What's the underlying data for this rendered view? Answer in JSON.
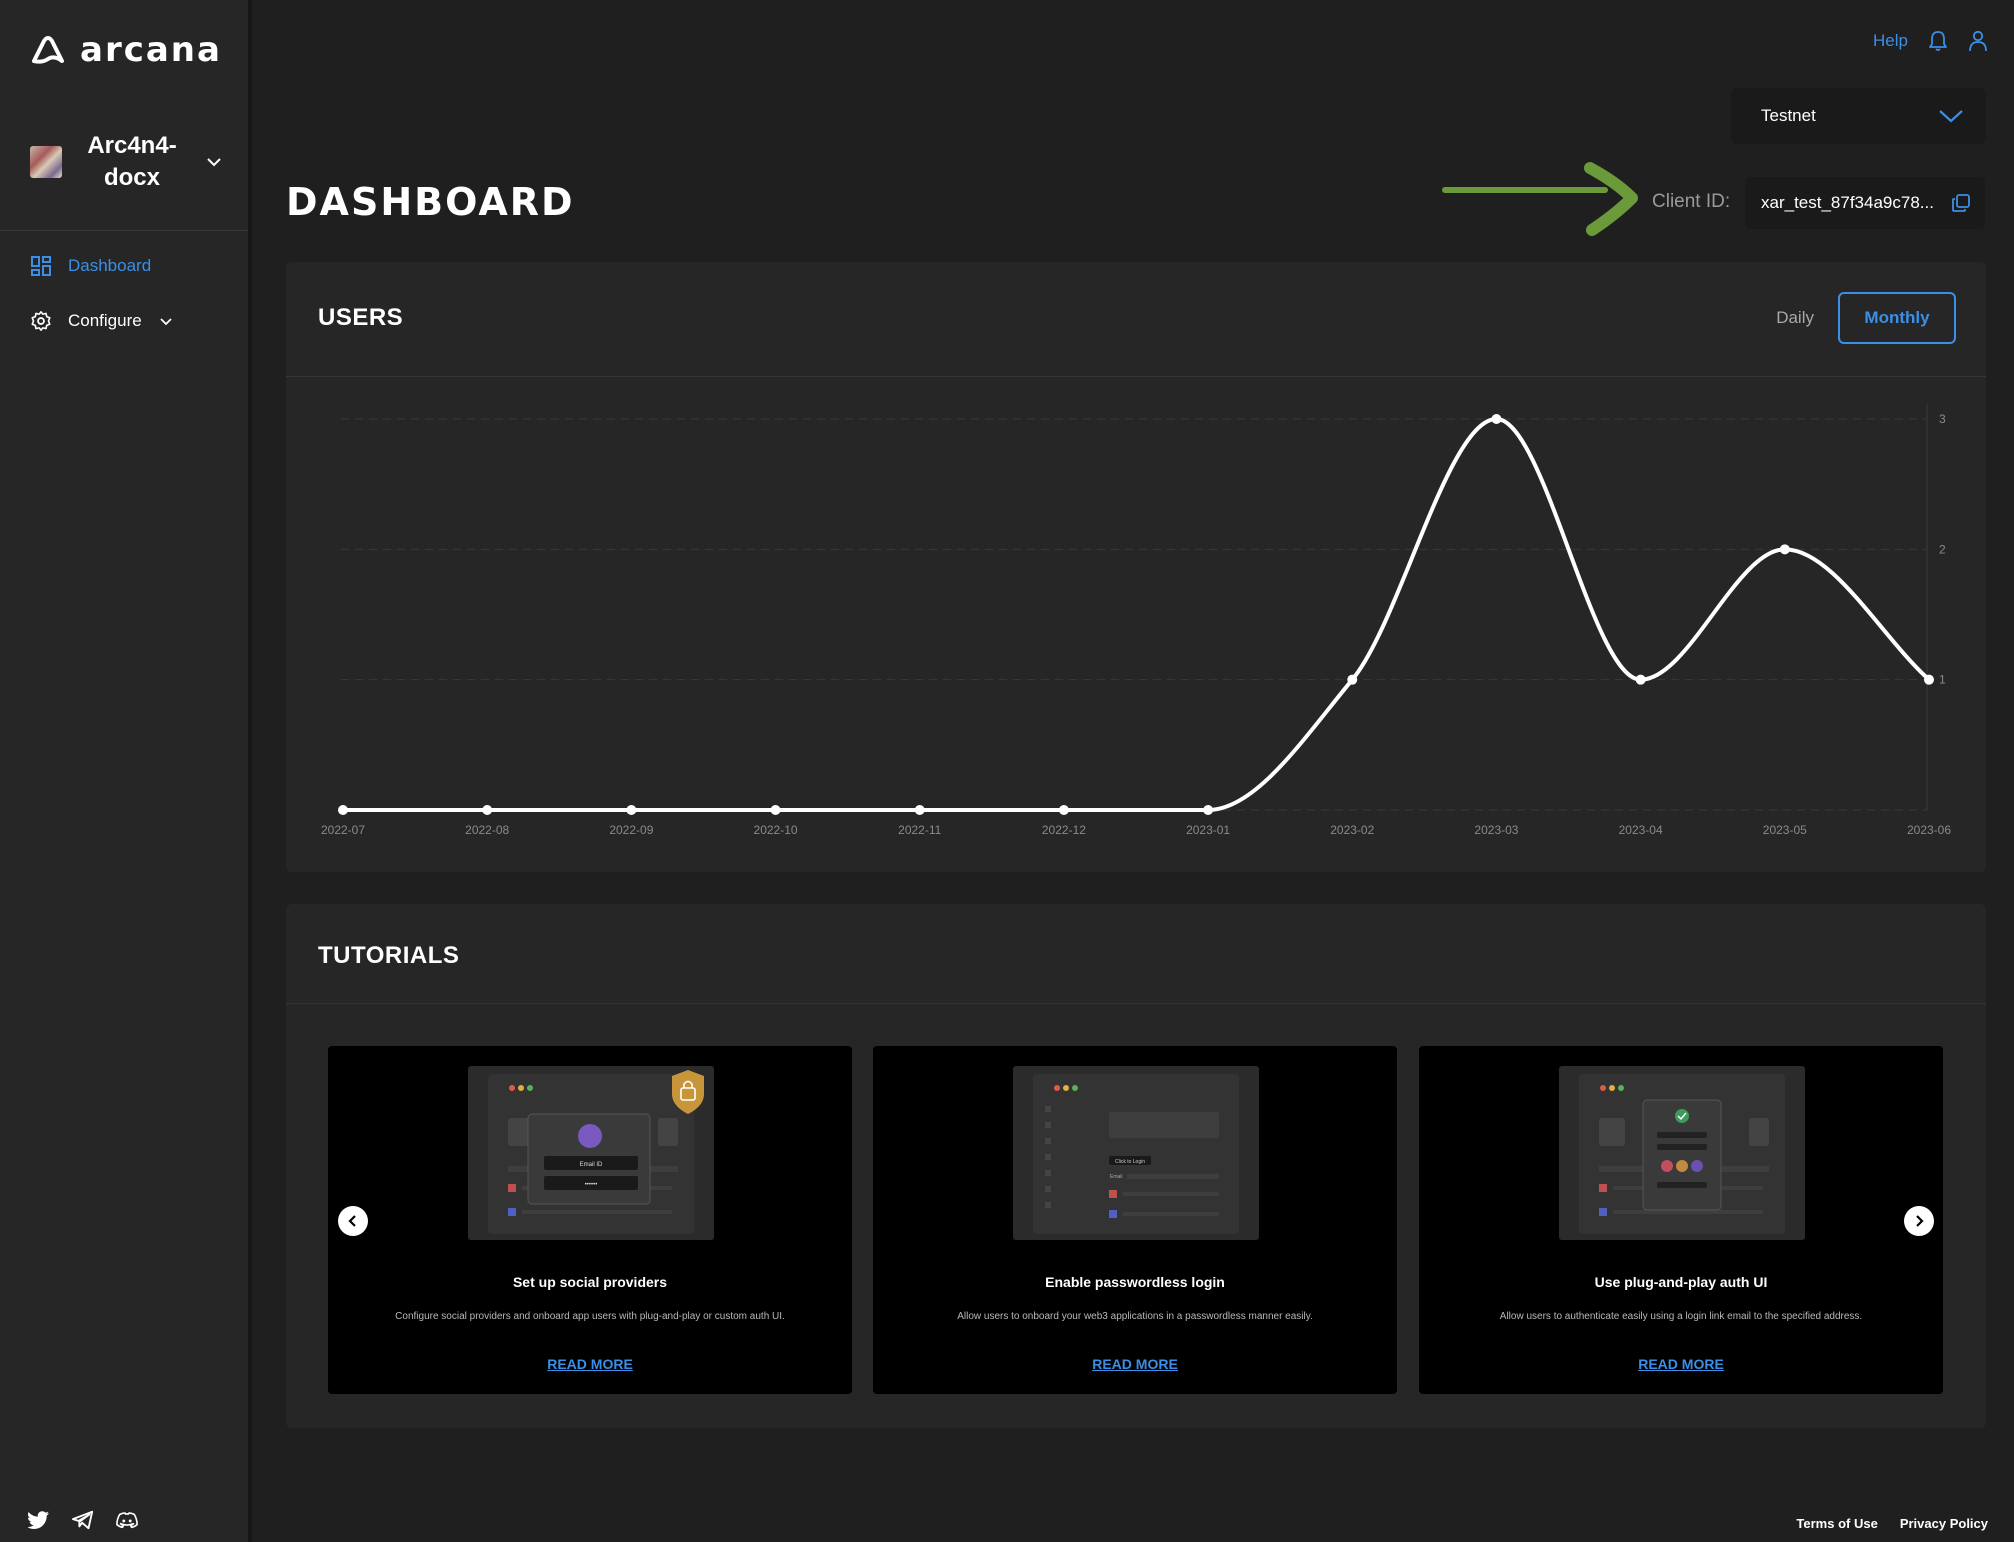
{
  "brand": {
    "name": "arcana"
  },
  "app": {
    "name": "Arc4n4-\ndocx"
  },
  "nav": {
    "dashboard": "Dashboard",
    "configure": "Configure"
  },
  "header": {
    "help": "Help",
    "network": "Testnet",
    "page_title": "DASHBOARD",
    "client_label": "Client ID:",
    "client_id": "xar_test_87f34a9c78..."
  },
  "users": {
    "title": "USERS",
    "toggle_daily": "Daily",
    "toggle_monthly": "Monthly"
  },
  "chart_data": {
    "type": "line",
    "x": [
      "2022-07",
      "2022-08",
      "2022-09",
      "2022-10",
      "2022-11",
      "2022-12",
      "2023-01",
      "2023-02",
      "2023-03",
      "2023-04",
      "2023-05",
      "2023-06"
    ],
    "series": [
      {
        "values": [
          0,
          0,
          0,
          0,
          0,
          0,
          0,
          1,
          3,
          1,
          2,
          1
        ]
      }
    ],
    "yticks": [
      "1",
      "2",
      "3"
    ],
    "ylim": [
      0,
      3
    ],
    "grid": true,
    "y_axis_side": "right",
    "line_color": "#ffffff"
  },
  "tutorials": {
    "title": "TUTORIALS",
    "items": [
      {
        "title": "Set up social providers",
        "desc": "Configure social providers and onboard app users with plug-and-play or custom auth UI.",
        "link": "READ MORE"
      },
      {
        "title": "Enable passwordless login",
        "desc": "Allow users to onboard your web3 applications in a passwordless manner easily.",
        "link": "READ MORE"
      },
      {
        "title": "Use plug-and-play auth UI",
        "desc": "Allow users to authenticate easily using a login link email to the specified address.",
        "link": "READ MORE"
      }
    ],
    "thumb_text": {
      "email_label": "Email ID",
      "password_mask": "••••••",
      "click_login": "Click to Login",
      "email_small": "Email"
    }
  },
  "footer": {
    "terms": "Terms of Use",
    "privacy": "Privacy Policy"
  },
  "colors": {
    "accent": "#3b8fe6",
    "annotation_arrow": "#6a9a3a",
    "background": "#1f1f1f",
    "card": "#262626"
  }
}
